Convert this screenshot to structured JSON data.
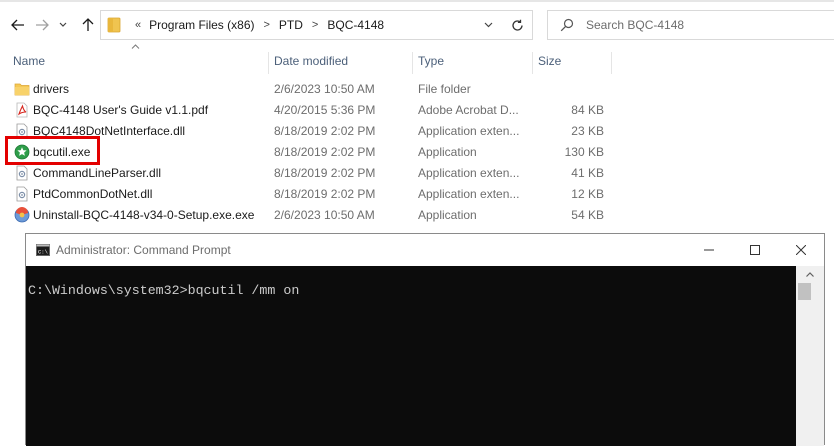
{
  "explorer": {
    "address": {
      "overflow_chevron": "«",
      "crumbs": [
        "Program Files (x86)",
        "PTD",
        "BQC-4148"
      ]
    },
    "search": {
      "placeholder": "Search BQC-4148"
    },
    "columns": {
      "name": "Name",
      "date_modified": "Date modified",
      "type": "Type",
      "size": "Size"
    },
    "files": [
      {
        "name": "drivers",
        "date": "2/6/2023 10:50 AM",
        "type": "File folder",
        "size": "",
        "icon": "folder-icon"
      },
      {
        "name": "BQC-4148 User's Guide v1.1.pdf",
        "date": "4/20/2015 5:36 PM",
        "type": "Adobe Acrobat D...",
        "size": "84 KB",
        "icon": "pdf-icon"
      },
      {
        "name": "BQC4148DotNetInterface.dll",
        "date": "8/18/2019 2:02 PM",
        "type": "Application exten...",
        "size": "23 KB",
        "icon": "dll-icon"
      },
      {
        "name": "bqcutil.exe",
        "date": "8/18/2019 2:02 PM",
        "type": "Application",
        "size": "130 KB",
        "icon": "exe-icon"
      },
      {
        "name": "CommandLineParser.dll",
        "date": "8/18/2019 2:02 PM",
        "type": "Application exten...",
        "size": "41 KB",
        "icon": "dll-icon"
      },
      {
        "name": "PtdCommonDotNet.dll",
        "date": "8/18/2019 2:02 PM",
        "type": "Application exten...",
        "size": "12 KB",
        "icon": "dll-icon"
      },
      {
        "name": "Uninstall-BQC-4148-v34-0-Setup.exe.exe",
        "date": "2/6/2023 10:50 AM",
        "type": "Application",
        "size": "54 KB",
        "icon": "installer-icon"
      }
    ],
    "highlight_color": "#e30000"
  },
  "cmd": {
    "title": "Administrator: Command Prompt",
    "prompt_line": "C:\\Windows\\system32>bqcutil /mm on"
  },
  "colors": {
    "header_text": "#4c607a",
    "console_bg": "#0c0c0c",
    "console_text": "#cccccc"
  }
}
